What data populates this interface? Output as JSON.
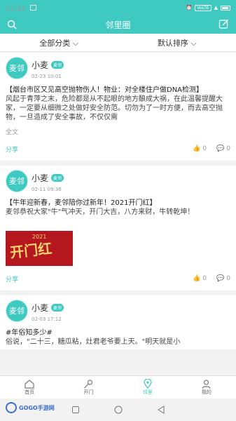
{
  "status": {
    "time": "11:41",
    "volte": "VoLTE"
  },
  "header": {
    "title": "邻里圈"
  },
  "filters": {
    "category": "全部分类",
    "sort": "默认排序"
  },
  "posts": [
    {
      "avatar_text": "麦邻",
      "name": "小麦",
      "badge": "麦邻",
      "time": "02-23 10:01",
      "title": "【烟台市区又见高空抛物伤人！物业：对全楼住户做DNA检测】",
      "body": "风起于青萍之末，危险都是从不起眼的地方酿成大祸，在此温馨提醒大家，一定要从细微之处做好安全防范。切勿为了一时方便，而去高空抛物，一旦造成了安全事故，不仅仅需",
      "more": "全文",
      "share": "分享",
      "likes": "0",
      "comments": "0"
    },
    {
      "avatar_text": "麦邻",
      "name": "小麦",
      "badge": "麦邻",
      "time": "02-11 09:36",
      "title": "【牛年迎新春，麦邻陪你过新年！2021开门红】",
      "body": "麦邻恭祝大家\"牛\"气冲天，开门大吉，八方来财，牛转乾坤！",
      "promo_big": "开门红",
      "promo_year": "2021",
      "share": "分享",
      "likes": "0",
      "comments": "0"
    },
    {
      "avatar_text": "麦邻",
      "name": "小麦",
      "badge": "麦邻",
      "time": "02-03 17:12",
      "title": "#年俗知多少#",
      "body": "俗说，\"二十三，糖瓜粘，灶君老爷要上天。\"明天就是小"
    }
  ],
  "nav": [
    {
      "label": "首页",
      "icon": "home-icon"
    },
    {
      "label": "开门",
      "icon": "key-icon"
    },
    {
      "label": "邻里",
      "icon": "location-icon",
      "active": true
    },
    {
      "label": "我的",
      "icon": "user-icon"
    }
  ],
  "watermark": "GOGO手游网"
}
